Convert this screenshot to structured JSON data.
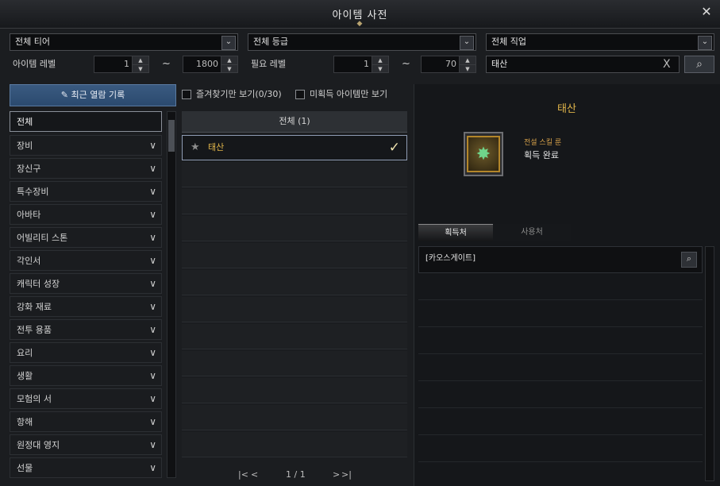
{
  "window": {
    "title": "아이템 사전",
    "close_icon": "close-icon"
  },
  "filters": {
    "tier": "전체 티어",
    "grade": "전체 등급",
    "class": "전체 직업",
    "item_level_label": "아이템 레벨",
    "item_level_min": "1",
    "item_level_max": "1800",
    "tilde": "~",
    "req_level_label": "필요 레벨",
    "req_level_min": "1",
    "req_level_max": "70",
    "search_value": "태산",
    "search_clear": "X",
    "search_button_icon": "search-icon"
  },
  "sidebar": {
    "recent_label": "최근 열람 기록",
    "categories": [
      "전체",
      "장비",
      "장신구",
      "특수장비",
      "아바타",
      "어빌리티 스톤",
      "각인서",
      "캐릭터 성장",
      "강화 재료",
      "전투 용품",
      "요리",
      "생활",
      "모험의 서",
      "항해",
      "원정대 영지",
      "선물"
    ]
  },
  "list": {
    "fav_only_label": "즐겨찾기만 보기(0/30)",
    "unowned_only_label": "미획득 아이템만 보기",
    "header": "전체 (1)",
    "items": [
      {
        "name": "태산",
        "star": "★",
        "check": "✓"
      }
    ],
    "pager": {
      "first": "|<",
      "prev": "<",
      "page": "1 / 1",
      "next": ">",
      "last": ">|"
    }
  },
  "detail": {
    "name": "태산",
    "type": "전설 스킬 룬",
    "status": "획득 완료",
    "tabs": [
      "획득처",
      "사용처"
    ],
    "sources": [
      "[카오스게이트]"
    ]
  },
  "colors": {
    "accent_gold": "#e2b64a",
    "button_blue": "#2b4a6f"
  }
}
